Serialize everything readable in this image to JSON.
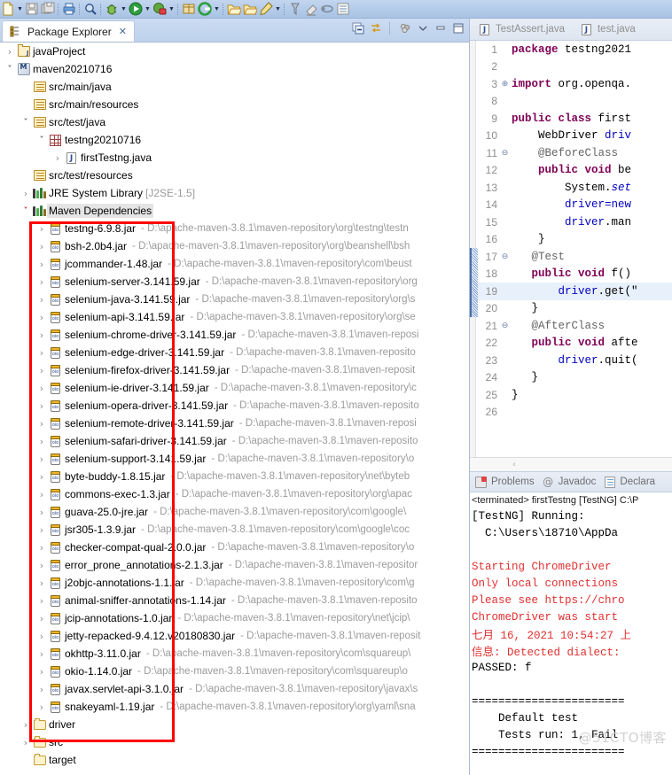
{
  "toolbar": {
    "items": [
      {
        "icon": "new-file-icon",
        "arrow": true
      },
      {
        "icon": "save-icon",
        "arrow": false
      },
      {
        "icon": "save-all-icon",
        "arrow": false
      },
      {
        "sep": true
      },
      {
        "icon": "print-icon",
        "arrow": false
      },
      {
        "sep": true
      },
      {
        "icon": "search-icon",
        "arrow": false
      },
      {
        "sep": true
      },
      {
        "icon": "debug-icon",
        "arrow": true
      },
      {
        "icon": "run-icon",
        "arrow": true
      },
      {
        "icon": "run-external-tools-icon",
        "arrow": true
      },
      {
        "sep": true
      },
      {
        "icon": "new-package-icon",
        "arrow": false
      },
      {
        "icon": "coverage-icon",
        "arrow": true
      },
      {
        "sep": true
      },
      {
        "icon": "open-folder-icon",
        "arrow": false
      },
      {
        "icon": "open-type-icon",
        "arrow": false
      },
      {
        "icon": "edit-icon",
        "arrow": true
      },
      {
        "sep": true
      },
      {
        "icon": "pin-icon",
        "arrow": false
      },
      {
        "icon": "eraser-icon",
        "arrow": false
      },
      {
        "icon": "link-icon",
        "arrow": false
      },
      {
        "icon": "list-icon",
        "arrow": false
      }
    ]
  },
  "package_explorer": {
    "tab_label": "Package Explorer",
    "close_glyph": "✕",
    "view_icons": [
      {
        "name": "collapse-all-icon"
      },
      {
        "name": "link-with-editor-icon"
      },
      {
        "name": "view-menu-filter-icon"
      },
      {
        "name": "view-menu-icon"
      },
      {
        "name": "minimize-view-icon"
      },
      {
        "name": "maximize-view-icon"
      }
    ],
    "tree": [
      {
        "indent": 0,
        "twisty": "›",
        "icon": "project-icon",
        "label": "javaProject",
        "path": ""
      },
      {
        "indent": 0,
        "twisty": "⌄",
        "icon": "maven-project-icon",
        "label": "maven20210716",
        "path": ""
      },
      {
        "indent": 1,
        "twisty": "",
        "icon": "source-folder-icon",
        "label": "src/main/java",
        "path": ""
      },
      {
        "indent": 1,
        "twisty": "",
        "icon": "source-folder-icon",
        "label": "src/main/resources",
        "path": ""
      },
      {
        "indent": 1,
        "twisty": "⌄",
        "icon": "source-folder-icon",
        "label": "src/test/java",
        "path": ""
      },
      {
        "indent": 2,
        "twisty": "⌄",
        "icon": "package-icon",
        "label": "testng20210716",
        "path": ""
      },
      {
        "indent": 3,
        "twisty": "›",
        "icon": "java-file-icon",
        "label": "firstTestng.java",
        "path": ""
      },
      {
        "indent": 1,
        "twisty": "",
        "icon": "source-folder-icon",
        "label": "src/test/resources",
        "path": ""
      },
      {
        "indent": 1,
        "twisty": "›",
        "icon": "library-icon",
        "label": "JRE System Library",
        "dim": "[J2SE-1.5]",
        "path": ""
      },
      {
        "indent": 1,
        "twisty": "⌄",
        "icon": "library-icon",
        "label": "Maven Dependencies",
        "path": "",
        "selected": true
      },
      {
        "indent": 2,
        "twisty": "›",
        "icon": "jar-icon",
        "label": "testng-6.9.8.jar",
        "path": "- D:\\apache-maven-3.8.1\\maven-repository\\org\\testng\\testn"
      },
      {
        "indent": 2,
        "twisty": "›",
        "icon": "jar-icon",
        "label": "bsh-2.0b4.jar",
        "path": "- D:\\apache-maven-3.8.1\\maven-repository\\org\\beanshell\\bsh"
      },
      {
        "indent": 2,
        "twisty": "›",
        "icon": "jar-icon",
        "label": "jcommander-1.48.jar",
        "path": "- D:\\apache-maven-3.8.1\\maven-repository\\com\\beust"
      },
      {
        "indent": 2,
        "twisty": "›",
        "icon": "jar-icon",
        "label": "selenium-server-3.141.59.jar",
        "path": "- D:\\apache-maven-3.8.1\\maven-repository\\org"
      },
      {
        "indent": 2,
        "twisty": "›",
        "icon": "jar-icon",
        "label": "selenium-java-3.141.59.jar",
        "path": "- D:\\apache-maven-3.8.1\\maven-repository\\org\\s"
      },
      {
        "indent": 2,
        "twisty": "›",
        "icon": "jar-icon",
        "label": "selenium-api-3.141.59.jar",
        "path": "- D:\\apache-maven-3.8.1\\maven-repository\\org\\se"
      },
      {
        "indent": 2,
        "twisty": "›",
        "icon": "jar-icon",
        "label": "selenium-chrome-driver-3.141.59.jar",
        "path": "- D:\\apache-maven-3.8.1\\maven-reposi"
      },
      {
        "indent": 2,
        "twisty": "›",
        "icon": "jar-icon",
        "label": "selenium-edge-driver-3.141.59.jar",
        "path": "- D:\\apache-maven-3.8.1\\maven-reposito"
      },
      {
        "indent": 2,
        "twisty": "›",
        "icon": "jar-icon",
        "label": "selenium-firefox-driver-3.141.59.jar",
        "path": "- D:\\apache-maven-3.8.1\\maven-reposit"
      },
      {
        "indent": 2,
        "twisty": "›",
        "icon": "jar-icon",
        "label": "selenium-ie-driver-3.141.59.jar",
        "path": "- D:\\apache-maven-3.8.1\\maven-repository\\c"
      },
      {
        "indent": 2,
        "twisty": "›",
        "icon": "jar-icon",
        "label": "selenium-opera-driver-3.141.59.jar",
        "path": "- D:\\apache-maven-3.8.1\\maven-reposito"
      },
      {
        "indent": 2,
        "twisty": "›",
        "icon": "jar-icon",
        "label": "selenium-remote-driver-3.141.59.jar",
        "path": "- D:\\apache-maven-3.8.1\\maven-reposi"
      },
      {
        "indent": 2,
        "twisty": "›",
        "icon": "jar-icon",
        "label": "selenium-safari-driver-3.141.59.jar",
        "path": "- D:\\apache-maven-3.8.1\\maven-reposito"
      },
      {
        "indent": 2,
        "twisty": "›",
        "icon": "jar-icon",
        "label": "selenium-support-3.141.59.jar",
        "path": "- D:\\apache-maven-3.8.1\\maven-repository\\o"
      },
      {
        "indent": 2,
        "twisty": "›",
        "icon": "jar-icon",
        "label": "byte-buddy-1.8.15.jar",
        "path": "- D:\\apache-maven-3.8.1\\maven-repository\\net\\byteb"
      },
      {
        "indent": 2,
        "twisty": "›",
        "icon": "jar-icon",
        "label": "commons-exec-1.3.jar",
        "path": "- D:\\apache-maven-3.8.1\\maven-repository\\org\\apac"
      },
      {
        "indent": 2,
        "twisty": "›",
        "icon": "jar-icon",
        "label": "guava-25.0-jre.jar",
        "path": "- D:\\apache-maven-3.8.1\\maven-repository\\com\\google\\"
      },
      {
        "indent": 2,
        "twisty": "›",
        "icon": "jar-icon",
        "label": "jsr305-1.3.9.jar",
        "path": "- D:\\apache-maven-3.8.1\\maven-repository\\com\\google\\coc"
      },
      {
        "indent": 2,
        "twisty": "›",
        "icon": "jar-icon",
        "label": "checker-compat-qual-2.0.0.jar",
        "path": "- D:\\apache-maven-3.8.1\\maven-repository\\o"
      },
      {
        "indent": 2,
        "twisty": "›",
        "icon": "jar-icon",
        "label": "error_prone_annotations-2.1.3.jar",
        "path": "- D:\\apache-maven-3.8.1\\maven-repositor"
      },
      {
        "indent": 2,
        "twisty": "›",
        "icon": "jar-icon",
        "label": "j2objc-annotations-1.1.jar",
        "path": "- D:\\apache-maven-3.8.1\\maven-repository\\com\\g"
      },
      {
        "indent": 2,
        "twisty": "›",
        "icon": "jar-icon",
        "label": "animal-sniffer-annotations-1.14.jar",
        "path": "- D:\\apache-maven-3.8.1\\maven-reposito"
      },
      {
        "indent": 2,
        "twisty": "›",
        "icon": "jar-icon",
        "label": "jcip-annotations-1.0.jar",
        "path": "- D:\\apache-maven-3.8.1\\maven-repository\\net\\jcip\\"
      },
      {
        "indent": 2,
        "twisty": "›",
        "icon": "jar-icon",
        "label": "jetty-repacked-9.4.12.v20180830.jar",
        "path": "- D:\\apache-maven-3.8.1\\maven-reposit"
      },
      {
        "indent": 2,
        "twisty": "›",
        "icon": "jar-icon",
        "label": "okhttp-3.11.0.jar",
        "path": "- D:\\apache-maven-3.8.1\\maven-repository\\com\\squareup\\"
      },
      {
        "indent": 2,
        "twisty": "›",
        "icon": "jar-icon",
        "label": "okio-1.14.0.jar",
        "path": "- D:\\apache-maven-3.8.1\\maven-repository\\com\\squareup\\o"
      },
      {
        "indent": 2,
        "twisty": "›",
        "icon": "jar-icon",
        "label": "javax.servlet-api-3.1.0.jar",
        "path": "- D:\\apache-maven-3.8.1\\maven-repository\\javax\\s"
      },
      {
        "indent": 2,
        "twisty": "›",
        "icon": "jar-icon",
        "label": "snakeyaml-1.19.jar",
        "path": "- D:\\apache-maven-3.8.1\\maven-repository\\org\\yaml\\sna"
      },
      {
        "indent": 1,
        "twisty": "›",
        "icon": "folder-icon",
        "label": "driver",
        "path": ""
      },
      {
        "indent": 1,
        "twisty": "›",
        "icon": "folder-icon",
        "label": "src",
        "path": ""
      },
      {
        "indent": 1,
        "twisty": "",
        "icon": "folder-icon",
        "label": "target",
        "path": ""
      }
    ],
    "annotation": {
      "color": "#ff0000",
      "shape": "rectangle"
    }
  },
  "editor": {
    "tabs": [
      {
        "label": "TestAssert.java",
        "icon": "java-file-icon",
        "active": false
      },
      {
        "label": "test.java",
        "icon": "java-file-icon",
        "active": false
      }
    ],
    "lines": [
      {
        "num": "1",
        "fold": "",
        "tokens": [
          {
            "t": "package",
            "c": "kw"
          },
          {
            "t": " testng2021",
            "c": "plain"
          }
        ]
      },
      {
        "num": "2",
        "fold": "",
        "tokens": []
      },
      {
        "num": "3",
        "fold": "⊕",
        "tokens": [
          {
            "t": "import",
            "c": "kw"
          },
          {
            "t": " org.openqa.",
            "c": "plain"
          }
        ]
      },
      {
        "num": "8",
        "fold": "",
        "tokens": []
      },
      {
        "num": "9",
        "fold": "",
        "tokens": [
          {
            "t": "public class",
            "c": "kw"
          },
          {
            "t": " first",
            "c": "cls"
          }
        ]
      },
      {
        "num": "10",
        "fold": "",
        "tokens": [
          {
            "t": "    WebDriver ",
            "c": "plain"
          },
          {
            "t": "driv",
            "c": "fld"
          }
        ]
      },
      {
        "num": "11",
        "fold": "⊖",
        "tokens": [
          {
            "t": "    @BeforeClass",
            "c": "ann"
          }
        ]
      },
      {
        "num": "12",
        "fold": "",
        "tokens": [
          {
            "t": "    ",
            "c": "plain"
          },
          {
            "t": "public void",
            "c": "kw"
          },
          {
            "t": " be",
            "c": "plain"
          }
        ]
      },
      {
        "num": "13",
        "fold": "",
        "tokens": [
          {
            "t": "        System.",
            "c": "plain"
          },
          {
            "t": "set",
            "c": "stat"
          }
        ]
      },
      {
        "num": "14",
        "fold": "",
        "tokens": [
          {
            "t": "        ",
            "c": "plain"
          },
          {
            "t": "driver=new",
            "c": "fld"
          }
        ]
      },
      {
        "num": "15",
        "fold": "",
        "tokens": [
          {
            "t": "        ",
            "c": "plain"
          },
          {
            "t": "driver",
            "c": "fld"
          },
          {
            "t": ".man",
            "c": "plain"
          }
        ]
      },
      {
        "num": "16",
        "fold": "",
        "tokens": [
          {
            "t": "    }",
            "c": "plain"
          }
        ]
      },
      {
        "num": "17",
        "fold": "⊖",
        "tokens": [
          {
            "t": "   @Test",
            "c": "ann"
          }
        ],
        "mark": true
      },
      {
        "num": "18",
        "fold": "",
        "tokens": [
          {
            "t": "   ",
            "c": "plain"
          },
          {
            "t": "public void",
            "c": "kw"
          },
          {
            "t": " f()",
            "c": "plain"
          }
        ],
        "mark": true
      },
      {
        "num": "19",
        "fold": "",
        "tokens": [
          {
            "t": "       ",
            "c": "plain"
          },
          {
            "t": "driver",
            "c": "fld"
          },
          {
            "t": ".get(\"",
            "c": "plain"
          }
        ],
        "mark": true,
        "highlight": true
      },
      {
        "num": "20",
        "fold": "",
        "tokens": [
          {
            "t": "   }",
            "c": "plain"
          }
        ],
        "mark": true
      },
      {
        "num": "21",
        "fold": "⊖",
        "tokens": [
          {
            "t": "   @AfterClass",
            "c": "ann"
          }
        ]
      },
      {
        "num": "22",
        "fold": "",
        "tokens": [
          {
            "t": "   ",
            "c": "plain"
          },
          {
            "t": "public void",
            "c": "kw"
          },
          {
            "t": " afte",
            "c": "plain"
          }
        ]
      },
      {
        "num": "23",
        "fold": "",
        "tokens": [
          {
            "t": "       ",
            "c": "plain"
          },
          {
            "t": "driver",
            "c": "fld"
          },
          {
            "t": ".quit(",
            "c": "plain"
          }
        ]
      },
      {
        "num": "24",
        "fold": "",
        "tokens": [
          {
            "t": "   }",
            "c": "plain"
          }
        ]
      },
      {
        "num": "25",
        "fold": "",
        "tokens": [
          {
            "t": "}",
            "c": "plain"
          }
        ]
      },
      {
        "num": "26",
        "fold": "",
        "tokens": []
      }
    ],
    "hscroll_glyph": "‹"
  },
  "console": {
    "tabs": [
      {
        "label": "Problems",
        "icon": "problems-icon"
      },
      {
        "label": "Javadoc",
        "icon": "javadoc-icon"
      },
      {
        "label": "Declara",
        "icon": "declaration-icon"
      }
    ],
    "header": "<terminated> firstTestng [TestNG] C:\\P",
    "lines": [
      {
        "text": "[TestNG] Running:",
        "red": false
      },
      {
        "text": "  C:\\Users\\18710\\AppDa",
        "red": false
      },
      {
        "text": "",
        "red": false
      },
      {
        "text": "Starting ChromeDriver",
        "red": true
      },
      {
        "text": "Only local connections",
        "red": true
      },
      {
        "text": "Please see https://chro",
        "red": true
      },
      {
        "text": "ChromeDriver was start",
        "red": true
      },
      {
        "text": "七月 16, 2021 10:54:27 上",
        "red": true
      },
      {
        "text": "信息: Detected dialect:",
        "red": true
      },
      {
        "text": "PASSED: f",
        "red": false
      },
      {
        "text": "",
        "red": false
      },
      {
        "text": "=======================",
        "red": false
      },
      {
        "text": "    Default test",
        "red": false
      },
      {
        "text": "    Tests run: 1, Fail",
        "red": false
      },
      {
        "text": "=======================",
        "red": false
      }
    ],
    "watermark": "@51CTO博客"
  }
}
